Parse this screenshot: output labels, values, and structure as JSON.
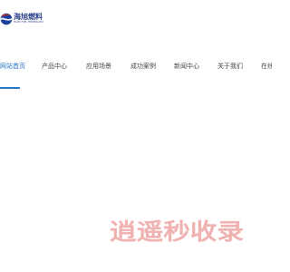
{
  "logo": {
    "name_cn": "海旭燃料",
    "name_en": "HAIXU FUEL TECHNOLOGY"
  },
  "nav": {
    "items": [
      {
        "label": "网站首页",
        "active": true
      },
      {
        "label": "产品中心",
        "active": false
      },
      {
        "label": "应用场景",
        "active": false
      },
      {
        "label": "成功案例",
        "active": false
      },
      {
        "label": "新闻中心",
        "active": false
      },
      {
        "label": "关于我们",
        "active": false
      },
      {
        "label": "在线",
        "active": false
      }
    ],
    "accent_color": "#1e73c8"
  },
  "watermark": {
    "text": "逍遥秒收录",
    "color": "#f0b1b1"
  }
}
